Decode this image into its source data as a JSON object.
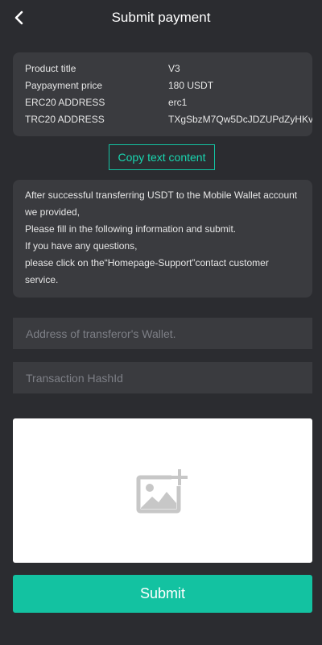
{
  "header": {
    "title": "Submit payment",
    "back_icon": "chevron-left-icon"
  },
  "info": {
    "rows": [
      {
        "label": "Product title",
        "value": "V3"
      },
      {
        "label": "Paypayment price",
        "value": "180 USDT"
      },
      {
        "label": "ERC20 ADDRESS",
        "value": "erc1"
      },
      {
        "label": "TRC20 ADDRESS",
        "value": "TXgSbzM7Qw5DcJDZUPdZyHKv"
      }
    ]
  },
  "copy_button": {
    "label": "Copy text content"
  },
  "notice": {
    "lines": [
      "After successful transferring USDT to the Mobile Wallet account",
      "we provided,",
      "Please fill in the following information and submit.",
      "If you have any questions,",
      "please click on the“Homepage-Support”contact customer",
      "service."
    ]
  },
  "form": {
    "wallet_placeholder": "Address of transferor's Wallet.",
    "wallet_value": "",
    "hash_placeholder": "Transaction HashId",
    "hash_value": "",
    "upload_icon": "add-image-icon"
  },
  "submit_button": {
    "label": "Submit"
  },
  "colors": {
    "accent": "#13c2a1",
    "background": "#2b2c30",
    "card": "#3a3b3f",
    "placeholder_icon": "#c7c7c7"
  }
}
